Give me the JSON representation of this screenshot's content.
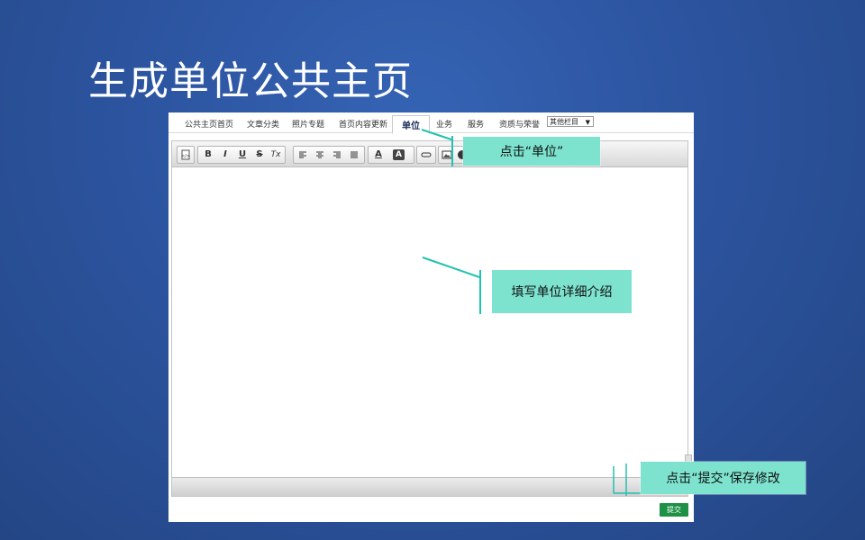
{
  "slide": {
    "title": "生成单位公共主页"
  },
  "tabs": [
    {
      "label": "公共主页首页"
    },
    {
      "label": "文章分类"
    },
    {
      "label": "照片专题"
    },
    {
      "label": "首页内容更新"
    },
    {
      "label": "单位",
      "active": true
    },
    {
      "label": "业务"
    },
    {
      "label": "服务"
    },
    {
      "label": "资质与荣誉"
    }
  ],
  "tab_select": {
    "value": "其他栏目"
  },
  "toolbar": {
    "icons": [
      "source-icon",
      "bold-icon",
      "italic-icon",
      "underline-icon",
      "strikethrough-icon",
      "remove-format-icon",
      "align-left-icon",
      "align-center-icon",
      "align-right-icon",
      "justify-icon",
      "text-color-icon",
      "background-color-icon",
      "link-icon",
      "image-icon",
      "flash-icon"
    ],
    "glyphs": {
      "bold": "B",
      "italic": "I",
      "underline": "U",
      "strike": "S",
      "clear": "Tx",
      "text_color": "A",
      "bg_color": "A"
    }
  },
  "submit": {
    "label": "提交",
    "color": "#1e9147"
  },
  "callouts": {
    "unit": "点击“单位”",
    "detail": "填写单位详细介绍",
    "submit": "点击“提交”保存修改"
  },
  "colors": {
    "callout_bg": "#7de3cf",
    "callout_line": "#21c2b0",
    "background": "#2c549f"
  }
}
